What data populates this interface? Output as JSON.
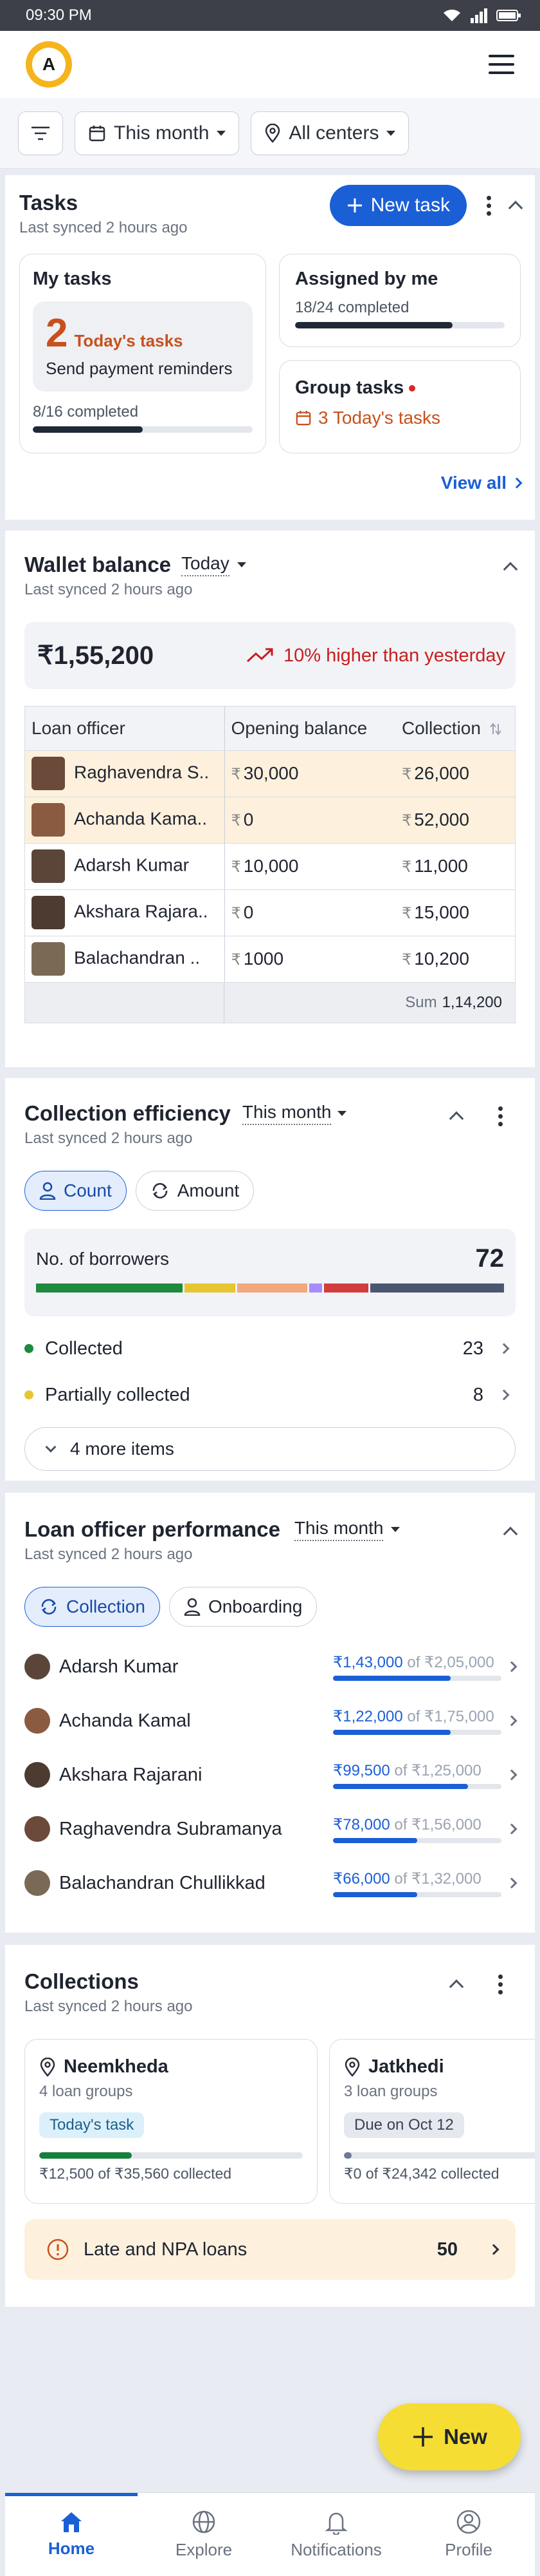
{
  "status_bar": {
    "time": "09:30 PM"
  },
  "filters": {
    "period": "This month",
    "centers": "All centers"
  },
  "tasks": {
    "title": "Tasks",
    "synced": "Last synced 2 hours ago",
    "new_task_label": "New task",
    "my_tasks": {
      "title": "My tasks",
      "count": "2",
      "count_label": "Today's tasks",
      "description": "Send payment reminders",
      "progress_text": "8/16 completed",
      "progress": 0.5
    },
    "assigned": {
      "title": "Assigned by me",
      "progress_text": "18/24 completed",
      "progress": 0.75
    },
    "group": {
      "title": "Group tasks",
      "today_text": "3 Today's tasks"
    },
    "view_all": "View all"
  },
  "wallet": {
    "title": "Wallet balance",
    "period": "Today",
    "synced": "Last synced 2 hours ago",
    "amount": "₹1,55,200",
    "trend": "10% higher than yesterday",
    "columns": [
      "Loan officer",
      "Opening balance",
      "Collection"
    ],
    "rows": [
      {
        "name": "Raghavendra S..",
        "opening": "30,000",
        "collection": "26,000",
        "highlight": true,
        "avatar": "#6b4a3a"
      },
      {
        "name": "Achanda Kama..",
        "opening": "0",
        "collection": "52,000",
        "highlight": true,
        "avatar": "#8a5b40"
      },
      {
        "name": "Adarsh Kumar",
        "opening": "10,000",
        "collection": "11,000",
        "highlight": false,
        "avatar": "#5a4538"
      },
      {
        "name": "Akshara Rajara..",
        "opening": "0",
        "collection": "15,000",
        "highlight": false,
        "avatar": "#4d3a30"
      },
      {
        "name": "Balachandran ..",
        "opening": "1000",
        "collection": "10,200",
        "highlight": false,
        "avatar": "#7a6a55"
      }
    ],
    "sum_label": "Sum",
    "sum_value": "1,14,200"
  },
  "efficiency": {
    "title": "Collection efficiency",
    "period": "This month",
    "synced": "Last synced 2 hours ago",
    "toggle_count": "Count",
    "toggle_amount": "Amount",
    "borrowers_label": "No. of borrowers",
    "borrowers_total": "72",
    "segments": [
      {
        "color": "#1e8a3e",
        "value": 23
      },
      {
        "color": "#e7c531",
        "value": 8
      },
      {
        "color": "#f2a77c",
        "value": 11
      },
      {
        "color": "#a78bfa",
        "value": 2
      },
      {
        "color": "#d23c3c",
        "value": 7
      },
      {
        "color": "#4b5670",
        "value": 21
      }
    ],
    "items": [
      {
        "label": "Collected",
        "value": "23",
        "color": "#1e8a3e"
      },
      {
        "label": "Partially collected",
        "value": "8",
        "color": "#e7c531"
      }
    ],
    "more_label": "4 more items"
  },
  "performance": {
    "title": "Loan officer performance",
    "period": "This month",
    "synced": "Last synced 2 hours ago",
    "toggle_collection": "Collection",
    "toggle_onboarding": "Onboarding",
    "rows": [
      {
        "name": "Adarsh Kumar",
        "amount": "₹1,43,000",
        "target": "of ₹2,05,000",
        "progress": 0.7,
        "avatar": "#5a4538"
      },
      {
        "name": "Achanda Kamal",
        "amount": "₹1,22,000",
        "target": "of ₹1,75,000",
        "progress": 0.7,
        "avatar": "#8a5b40"
      },
      {
        "name": "Akshara Rajarani",
        "amount": "₹99,500",
        "target": "of ₹1,25,000",
        "progress": 0.8,
        "avatar": "#4d3a30"
      },
      {
        "name": "Raghavendra Subramanya",
        "amount": "₹78,000",
        "target": "of ₹1,56,000",
        "progress": 0.5,
        "avatar": "#6b4a3a"
      },
      {
        "name": "Balachandran Chullikkad",
        "amount": "₹66,000",
        "target": "of ₹1,32,000",
        "progress": 0.5,
        "avatar": "#7a6a55"
      }
    ]
  },
  "collections": {
    "title": "Collections",
    "synced": "Last synced 2 hours ago",
    "centers": [
      {
        "name": "Neemkheda",
        "groups": "4 loan groups",
        "badge": "Today's task",
        "badge_bg": "#dcf0fb",
        "badge_color": "#1d5f8a",
        "collected": "₹12,500 of ₹35,560 collected",
        "progress": 0.35
      },
      {
        "name": "Jatkhedi",
        "groups": "3 loan groups",
        "badge": "Due on Oct 12",
        "badge_bg": "#e5e8ee",
        "badge_color": "#3a4150",
        "collected": "₹0 of ₹24,342 collected",
        "progress": 0.03
      }
    ],
    "late_label": "Late and NPA loans",
    "late_count": "50"
  },
  "fab_label": "New",
  "nav": [
    {
      "label": "Home",
      "icon": "home-icon"
    },
    {
      "label": "Explore",
      "icon": "globe-icon"
    },
    {
      "label": "Notifications",
      "icon": "bell-icon"
    },
    {
      "label": "Profile",
      "icon": "profile-icon"
    }
  ]
}
